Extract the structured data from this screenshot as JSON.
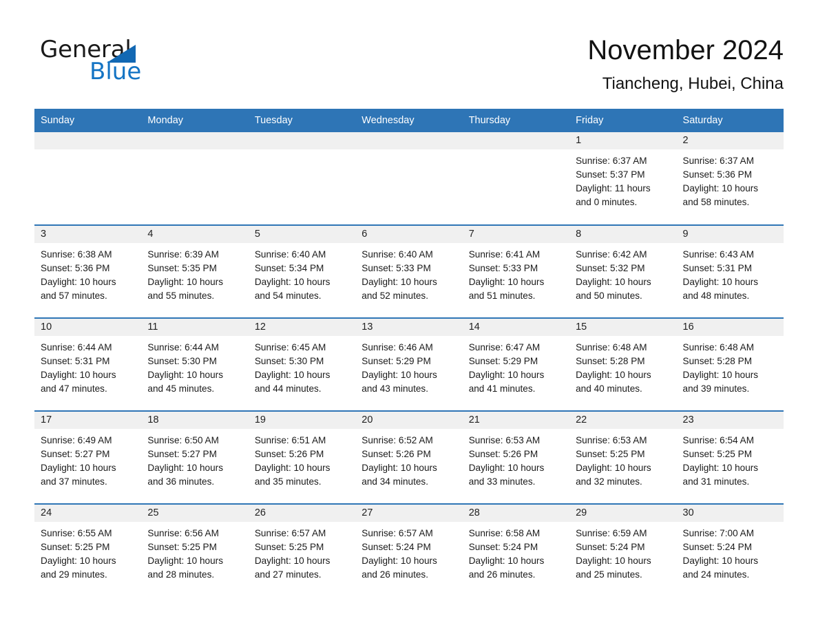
{
  "logo": {
    "text_primary": "General",
    "text_secondary": "Blue",
    "triangle_color": "#1268b3",
    "blue_color": "#1474c4"
  },
  "header": {
    "month_title": "November 2024",
    "location": "Tiancheng, Hubei, China"
  },
  "theme": {
    "header_blue": "#2e75b6",
    "daynum_band": "#f0f0f0",
    "page_background": "#ffffff",
    "text": "#1a1a1a"
  },
  "weekday_headers": [
    "Sunday",
    "Monday",
    "Tuesday",
    "Wednesday",
    "Thursday",
    "Friday",
    "Saturday"
  ],
  "weeks": [
    [
      {
        "day": "",
        "empty": true
      },
      {
        "day": "",
        "empty": true
      },
      {
        "day": "",
        "empty": true
      },
      {
        "day": "",
        "empty": true
      },
      {
        "day": "",
        "empty": true
      },
      {
        "day": "1",
        "sunrise": "Sunrise: 6:37 AM",
        "sunset": "Sunset: 5:37 PM",
        "daylight_1": "Daylight: 11 hours",
        "daylight_2": "and 0 minutes."
      },
      {
        "day": "2",
        "sunrise": "Sunrise: 6:37 AM",
        "sunset": "Sunset: 5:36 PM",
        "daylight_1": "Daylight: 10 hours",
        "daylight_2": "and 58 minutes."
      }
    ],
    [
      {
        "day": "3",
        "sunrise": "Sunrise: 6:38 AM",
        "sunset": "Sunset: 5:36 PM",
        "daylight_1": "Daylight: 10 hours",
        "daylight_2": "and 57 minutes."
      },
      {
        "day": "4",
        "sunrise": "Sunrise: 6:39 AM",
        "sunset": "Sunset: 5:35 PM",
        "daylight_1": "Daylight: 10 hours",
        "daylight_2": "and 55 minutes."
      },
      {
        "day": "5",
        "sunrise": "Sunrise: 6:40 AM",
        "sunset": "Sunset: 5:34 PM",
        "daylight_1": "Daylight: 10 hours",
        "daylight_2": "and 54 minutes."
      },
      {
        "day": "6",
        "sunrise": "Sunrise: 6:40 AM",
        "sunset": "Sunset: 5:33 PM",
        "daylight_1": "Daylight: 10 hours",
        "daylight_2": "and 52 minutes."
      },
      {
        "day": "7",
        "sunrise": "Sunrise: 6:41 AM",
        "sunset": "Sunset: 5:33 PM",
        "daylight_1": "Daylight: 10 hours",
        "daylight_2": "and 51 minutes."
      },
      {
        "day": "8",
        "sunrise": "Sunrise: 6:42 AM",
        "sunset": "Sunset: 5:32 PM",
        "daylight_1": "Daylight: 10 hours",
        "daylight_2": "and 50 minutes."
      },
      {
        "day": "9",
        "sunrise": "Sunrise: 6:43 AM",
        "sunset": "Sunset: 5:31 PM",
        "daylight_1": "Daylight: 10 hours",
        "daylight_2": "and 48 minutes."
      }
    ],
    [
      {
        "day": "10",
        "sunrise": "Sunrise: 6:44 AM",
        "sunset": "Sunset: 5:31 PM",
        "daylight_1": "Daylight: 10 hours",
        "daylight_2": "and 47 minutes."
      },
      {
        "day": "11",
        "sunrise": "Sunrise: 6:44 AM",
        "sunset": "Sunset: 5:30 PM",
        "daylight_1": "Daylight: 10 hours",
        "daylight_2": "and 45 minutes."
      },
      {
        "day": "12",
        "sunrise": "Sunrise: 6:45 AM",
        "sunset": "Sunset: 5:30 PM",
        "daylight_1": "Daylight: 10 hours",
        "daylight_2": "and 44 minutes."
      },
      {
        "day": "13",
        "sunrise": "Sunrise: 6:46 AM",
        "sunset": "Sunset: 5:29 PM",
        "daylight_1": "Daylight: 10 hours",
        "daylight_2": "and 43 minutes."
      },
      {
        "day": "14",
        "sunrise": "Sunrise: 6:47 AM",
        "sunset": "Sunset: 5:29 PM",
        "daylight_1": "Daylight: 10 hours",
        "daylight_2": "and 41 minutes."
      },
      {
        "day": "15",
        "sunrise": "Sunrise: 6:48 AM",
        "sunset": "Sunset: 5:28 PM",
        "daylight_1": "Daylight: 10 hours",
        "daylight_2": "and 40 minutes."
      },
      {
        "day": "16",
        "sunrise": "Sunrise: 6:48 AM",
        "sunset": "Sunset: 5:28 PM",
        "daylight_1": "Daylight: 10 hours",
        "daylight_2": "and 39 minutes."
      }
    ],
    [
      {
        "day": "17",
        "sunrise": "Sunrise: 6:49 AM",
        "sunset": "Sunset: 5:27 PM",
        "daylight_1": "Daylight: 10 hours",
        "daylight_2": "and 37 minutes."
      },
      {
        "day": "18",
        "sunrise": "Sunrise: 6:50 AM",
        "sunset": "Sunset: 5:27 PM",
        "daylight_1": "Daylight: 10 hours",
        "daylight_2": "and 36 minutes."
      },
      {
        "day": "19",
        "sunrise": "Sunrise: 6:51 AM",
        "sunset": "Sunset: 5:26 PM",
        "daylight_1": "Daylight: 10 hours",
        "daylight_2": "and 35 minutes."
      },
      {
        "day": "20",
        "sunrise": "Sunrise: 6:52 AM",
        "sunset": "Sunset: 5:26 PM",
        "daylight_1": "Daylight: 10 hours",
        "daylight_2": "and 34 minutes."
      },
      {
        "day": "21",
        "sunrise": "Sunrise: 6:53 AM",
        "sunset": "Sunset: 5:26 PM",
        "daylight_1": "Daylight: 10 hours",
        "daylight_2": "and 33 minutes."
      },
      {
        "day": "22",
        "sunrise": "Sunrise: 6:53 AM",
        "sunset": "Sunset: 5:25 PM",
        "daylight_1": "Daylight: 10 hours",
        "daylight_2": "and 32 minutes."
      },
      {
        "day": "23",
        "sunrise": "Sunrise: 6:54 AM",
        "sunset": "Sunset: 5:25 PM",
        "daylight_1": "Daylight: 10 hours",
        "daylight_2": "and 31 minutes."
      }
    ],
    [
      {
        "day": "24",
        "sunrise": "Sunrise: 6:55 AM",
        "sunset": "Sunset: 5:25 PM",
        "daylight_1": "Daylight: 10 hours",
        "daylight_2": "and 29 minutes."
      },
      {
        "day": "25",
        "sunrise": "Sunrise: 6:56 AM",
        "sunset": "Sunset: 5:25 PM",
        "daylight_1": "Daylight: 10 hours",
        "daylight_2": "and 28 minutes."
      },
      {
        "day": "26",
        "sunrise": "Sunrise: 6:57 AM",
        "sunset": "Sunset: 5:25 PM",
        "daylight_1": "Daylight: 10 hours",
        "daylight_2": "and 27 minutes."
      },
      {
        "day": "27",
        "sunrise": "Sunrise: 6:57 AM",
        "sunset": "Sunset: 5:24 PM",
        "daylight_1": "Daylight: 10 hours",
        "daylight_2": "and 26 minutes."
      },
      {
        "day": "28",
        "sunrise": "Sunrise: 6:58 AM",
        "sunset": "Sunset: 5:24 PM",
        "daylight_1": "Daylight: 10 hours",
        "daylight_2": "and 26 minutes."
      },
      {
        "day": "29",
        "sunrise": "Sunrise: 6:59 AM",
        "sunset": "Sunset: 5:24 PM",
        "daylight_1": "Daylight: 10 hours",
        "daylight_2": "and 25 minutes."
      },
      {
        "day": "30",
        "sunrise": "Sunrise: 7:00 AM",
        "sunset": "Sunset: 5:24 PM",
        "daylight_1": "Daylight: 10 hours",
        "daylight_2": "and 24 minutes."
      }
    ]
  ]
}
